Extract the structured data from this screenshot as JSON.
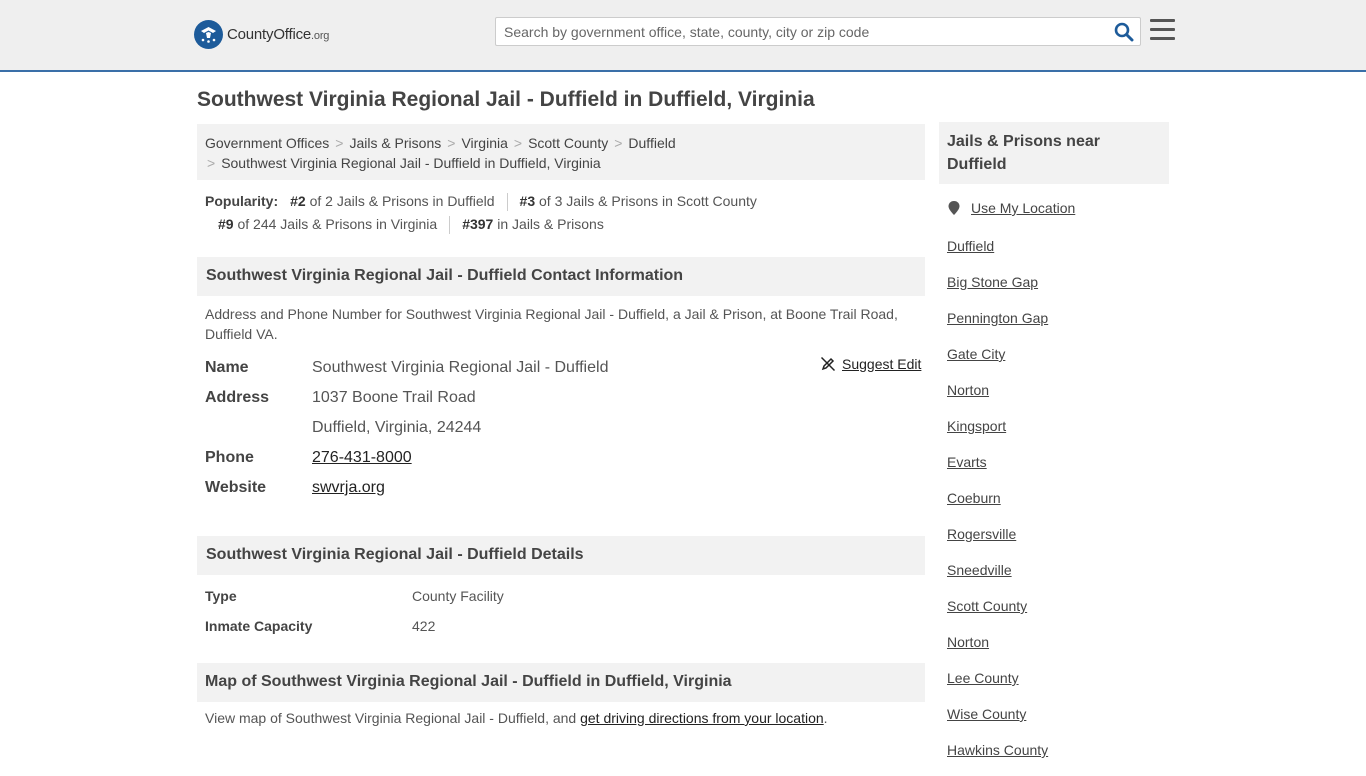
{
  "header": {
    "logo_main": "CountyOffice",
    "logo_suffix": ".org",
    "search_placeholder": "Search by government office, state, county, city or zip code"
  },
  "page_title": "Southwest Virginia Regional Jail - Duffield in Duffield, Virginia",
  "breadcrumb": [
    "Government Offices",
    "Jails & Prisons",
    "Virginia",
    "Scott County",
    "Duffield",
    "Southwest Virginia Regional Jail - Duffield in Duffield, Virginia"
  ],
  "popularity": {
    "label": "Popularity:",
    "items": [
      {
        "rank": "#2",
        "text": "of 2 Jails & Prisons in Duffield"
      },
      {
        "rank": "#3",
        "text": "of 3 Jails & Prisons in Scott County"
      },
      {
        "rank": "#9",
        "text": "of 244 Jails & Prisons in Virginia"
      },
      {
        "rank": "#397",
        "text": "in Jails & Prisons"
      }
    ]
  },
  "contact": {
    "heading": "Southwest Virginia Regional Jail - Duffield Contact Information",
    "description": "Address and Phone Number for Southwest Virginia Regional Jail - Duffield, a Jail & Prison, at Boone Trail Road, Duffield VA.",
    "suggest_edit": "Suggest Edit",
    "name_label": "Name",
    "name": "Southwest Virginia Regional Jail - Duffield",
    "address_label": "Address",
    "address_line1": "1037 Boone Trail Road",
    "address_line2": "Duffield, Virginia, 24244",
    "phone_label": "Phone",
    "phone": "276-431-8000",
    "website_label": "Website",
    "website": "swvrja.org"
  },
  "details": {
    "heading": "Southwest Virginia Regional Jail - Duffield Details",
    "type_label": "Type",
    "type": "County Facility",
    "capacity_label": "Inmate Capacity",
    "capacity": "422"
  },
  "map": {
    "heading": "Map of Southwest Virginia Regional Jail - Duffield in Duffield, Virginia",
    "desc_prefix": "View map of Southwest Virginia Regional Jail - Duffield, and",
    "desc_link": "get driving directions from your location",
    "desc_suffix": "."
  },
  "sidebar": {
    "heading": "Jails & Prisons near Duffield",
    "use_location": "Use My Location",
    "items": [
      "Duffield",
      "Big Stone Gap",
      "Pennington Gap",
      "Gate City",
      "Norton",
      "Kingsport",
      "Evarts",
      "Coeburn",
      "Rogersville",
      "Sneedville",
      "Scott County",
      "Norton",
      "Lee County",
      "Wise County",
      "Hawkins County"
    ]
  },
  "colors": {
    "header_bg": "#efefef",
    "header_border": "#3a6fa8",
    "search_icon": "#1d5b9a",
    "panel_bg": "#f2f2f2"
  },
  "icons": [
    "logo-seal-icon",
    "search-icon",
    "menu-icon",
    "suggest-edit-icon",
    "location-pin-icon"
  ]
}
